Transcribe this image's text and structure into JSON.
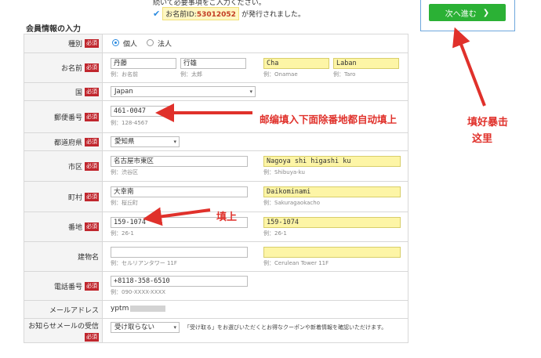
{
  "header": {
    "intro_text": "続いて必要事項をご入力ください。",
    "member_id_label": "お名前ID:",
    "member_id_value": "53012052",
    "member_id_suffix": "が発行されました。"
  },
  "next_button": {
    "label": "次へ進む",
    "icon": "chevron-right-icon"
  },
  "section_title": "会員情報の入力",
  "required_badge": "必須",
  "form": {
    "type": {
      "label": "種別",
      "options": [
        "個人",
        "法人"
      ],
      "selected": "個人"
    },
    "name": {
      "label": "お名前",
      "last": "丹藤",
      "first": "行雄",
      "last_hint": "例：お名前",
      "first_hint": "例：太郎",
      "last_en": "Cha",
      "first_en": "Laban",
      "last_en_hint": "例：Onamae",
      "first_en_hint": "例：Taro"
    },
    "country": {
      "label": "国",
      "value": "Japan"
    },
    "postal": {
      "label": "郵便番号",
      "value": "461-0047",
      "hint": "例：128-4567"
    },
    "prefecture": {
      "label": "都道府県",
      "value": "愛知県"
    },
    "city": {
      "label": "市区",
      "value": "名古屋市東区",
      "hint": "例：渋谷区",
      "value_en": "Nagoya shi higashi ku",
      "hint_en": "例：Shibuya-ku"
    },
    "town": {
      "label": "町村",
      "value": "大幸南",
      "hint": "例：桜丘町",
      "value_en": "Daikominami",
      "hint_en": "例：Sakuragaokacho"
    },
    "address": {
      "label": "番地",
      "value": "159-1074",
      "hint": "例：26-1",
      "value_en": "159-1074",
      "hint_en": "例：26-1"
    },
    "building": {
      "label": "建物名",
      "value": "",
      "hint": "例：セルリアンタワー 11F",
      "value_en": "",
      "hint_en": "例：Cerulean Tower 11F"
    },
    "phone": {
      "label": "電話番号",
      "value": "+8118-358-6510",
      "hint": "例：090-XXXX-XXXX"
    },
    "email": {
      "label": "メールアドレス",
      "value": "yptm"
    },
    "newsletter": {
      "label": "お知らせメールの受信",
      "value": "受け取らない",
      "note": "「受け取る」をお選びいただくとお得なクーポンや新着情報を確認いただけます。"
    }
  },
  "annotations": {
    "postal_note": "邮编填入下面除番地都自动填上",
    "fill_note": "填上",
    "next_note_line1": "填好暴击",
    "next_note_line2": "这里"
  },
  "colors": {
    "accent": "#2bb135",
    "required": "#c0262d",
    "highlight": "#fdf5a6",
    "annotation": "#e0312b"
  }
}
